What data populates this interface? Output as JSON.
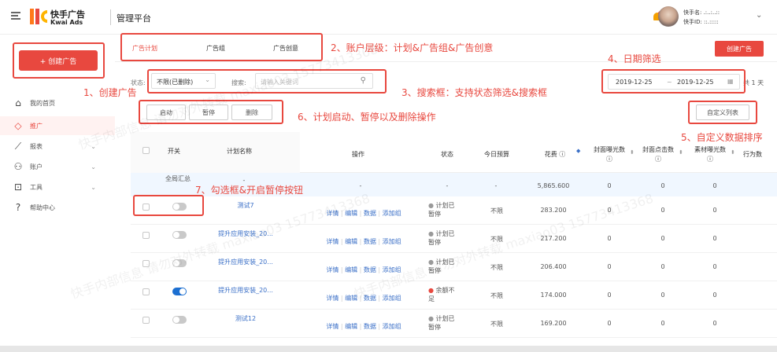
{
  "header": {
    "menu_icon": "menu-icon",
    "brand_cn": "快手广告",
    "brand_en": "Kwai Ads",
    "platform": "管理平台",
    "user_name": "快手名: .:..:..::",
    "user_id": "快手ID: ::.:::::"
  },
  "sidebar": {
    "create_label": "+ 创建广告",
    "items": [
      {
        "label": "我的首页",
        "icon": "home-icon",
        "chevron": false
      },
      {
        "label": "推广",
        "icon": "diamond-icon",
        "chevron": false,
        "active": true
      },
      {
        "label": "报表",
        "icon": "chart-icon",
        "chevron": true
      },
      {
        "label": "账户",
        "icon": "user-icon",
        "chevron": true
      },
      {
        "label": "工具",
        "icon": "toolbox-icon",
        "chevron": true
      },
      {
        "label": "帮助中心",
        "icon": "help-icon",
        "chevron": false
      }
    ]
  },
  "tabs": [
    "广告计划",
    "广告组",
    "广告创意"
  ],
  "create_ad_button": "创建广告",
  "filter": {
    "status_label": "状态:",
    "status_value": "不限(已删除)",
    "search_label": "搜索:",
    "search_placeholder": "请输入关键词"
  },
  "date": {
    "start": "2019-12-25",
    "sep": "~",
    "end": "2019-12-25",
    "total": "共 1 天"
  },
  "actions": {
    "start": "启动",
    "pause": "暂停",
    "delete": "删除",
    "custom_columns": "自定义列表"
  },
  "columns": {
    "switch": "开关",
    "plan_name": "计划名称",
    "ops": "操作",
    "status": "状态",
    "today_budget": "今日预算",
    "spend": "花费 ⓘ",
    "impressions": "封面曝光数 ⓘ",
    "clicks": "封面点击数 ⓘ",
    "material_imp": "素材曝光数 ⓘ",
    "action_count": "行为数"
  },
  "summary": {
    "label": "全局汇总",
    "name": "-",
    "ops": "-",
    "status": "-",
    "budget": "-",
    "spend": "5,865.600",
    "impressions": "0",
    "clicks": "0",
    "material_imp": "0"
  },
  "op_links": [
    "详情",
    "编辑",
    "数据",
    "添加组"
  ],
  "rows": [
    {
      "on": false,
      "name": "测试7",
      "status": "计划已暂停",
      "status_color": "#999",
      "budget": "不限",
      "spend": "283.200",
      "impressions": "0",
      "clicks": "0",
      "material_imp": "0"
    },
    {
      "on": false,
      "name": "提升应用安装_20...",
      "status": "计划已暂停",
      "status_color": "#999",
      "budget": "不限",
      "spend": "217.200",
      "impressions": "0",
      "clicks": "0",
      "material_imp": "0"
    },
    {
      "on": false,
      "name": "提升应用安装_20...",
      "status": "计划已暂停",
      "status_color": "#999",
      "budget": "不限",
      "spend": "206.400",
      "impressions": "0",
      "clicks": "0",
      "material_imp": "0"
    },
    {
      "on": true,
      "name": "提升应用安装_20...",
      "status": "余额不足",
      "status_color": "#e8483f",
      "budget": "不限",
      "spend": "174.000",
      "impressions": "0",
      "clicks": "0",
      "material_imp": "0"
    },
    {
      "on": false,
      "name": "测试12",
      "status": "计划已暂停",
      "status_color": "#999",
      "budget": "不限",
      "spend": "169.200",
      "impressions": "0",
      "clicks": "0",
      "material_imp": "0"
    }
  ],
  "annotations": {
    "a1": "1、创建广告",
    "a2": "2、账户层级：计划&广告组&广告创意",
    "a3": "3、搜索框：支持状态筛选&搜索框",
    "a4": "4、日期筛选",
    "a5": "5、自定义数据排序",
    "a6": "6、计划启动、暂停以及删除操作",
    "a7": "7、勾选框&开启暂停按钮"
  },
  "watermark": "快手内部信息 请勿对外转载 maxiao03 15773413368",
  "colors": {
    "accent": "#e8483f",
    "blue": "#1c6fd1",
    "link": "#3a6fc7"
  }
}
